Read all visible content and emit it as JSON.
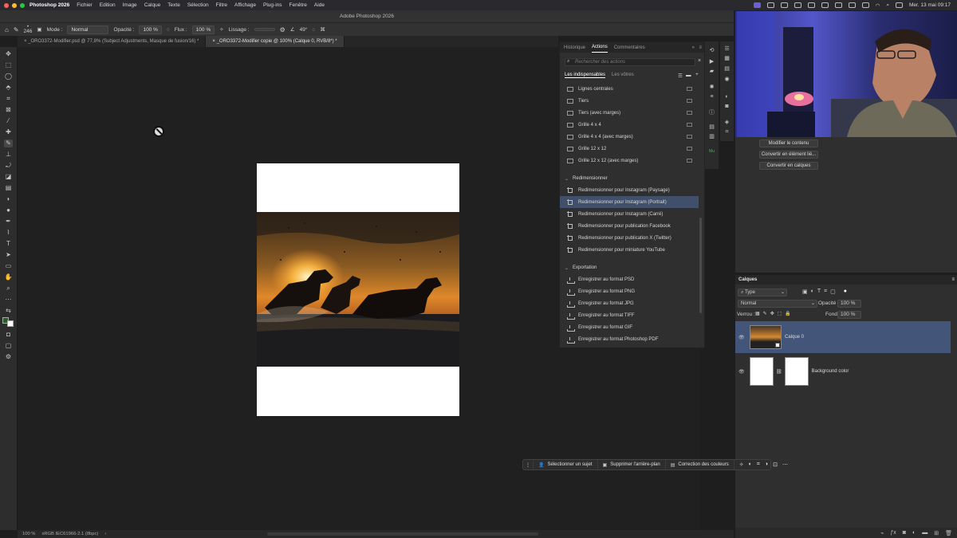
{
  "menubar": {
    "app_name": "Photoshop 2026",
    "items": [
      "Fichier",
      "Edition",
      "Image",
      "Calque",
      "Texte",
      "Sélection",
      "Filtre",
      "Affichage",
      "Plug-ins",
      "Fenêtre",
      "Aide"
    ],
    "datetime": "Mer. 13 mai 09:17"
  },
  "window_title": "Adobe Photoshop 2026",
  "options": {
    "brush_size": "246",
    "mode_label": "Mode :",
    "mode_value": "Normal",
    "opacity_label": "Opacité :",
    "opacity_value": "100 %",
    "flux_label": "Flux :",
    "flux_value": "100 %",
    "lissage_label": "Lissage :",
    "angle_value": "49°"
  },
  "tabs": [
    {
      "label": "_ORO3372-Modifier.psd @ 77,8% (Subject Adjustments, Masque de fusion/16) *"
    },
    {
      "label": "_ORO3372-Modifier copie @ 100% (Calque 0, RVB/8*) *"
    }
  ],
  "actions_panel": {
    "tabs": [
      "Historique",
      "Actions",
      "Commentaires"
    ],
    "search_placeholder": "Rechercher des actions",
    "sets": [
      "Les indispensables",
      "Les vôtres"
    ],
    "grid_items": [
      "Lignes centrales",
      "Tiers",
      "Tiers (avec marges)",
      "Grille 4 x 4",
      "Grille 4 x 4 (avec marges)",
      "Grille 12 x 12",
      "Grille 12 x 12 (avec marges)"
    ],
    "group_resize": "Redimensionner",
    "resize_items": [
      "Redimensionner pour Instagram (Paysage)",
      "Redimensionner pour Instagram (Portrait)",
      "Redimensionner pour Instagram (Carré)",
      "Redimensionner pour publication Facebook",
      "Redimensionner pour publication X (Twitter)",
      "Redimensionner pour miniature YouTube"
    ],
    "group_export": "Exportation",
    "export_items": [
      "Enregistrer au format PSD",
      "Enregistrer au format PNG",
      "Enregistrer au format JPG",
      "Enregistrer au format TIFF",
      "Enregistrer au format GIF",
      "Enregistrer au format Photoshop PDF"
    ]
  },
  "properties": {
    "buttons": [
      "Modifier le contenu",
      "Convertir en élément lié...",
      "Convertir en calques"
    ]
  },
  "layers": {
    "title": "Calques",
    "filter": "Type",
    "blend": "Normal",
    "opacity_label": "Opacité :",
    "opacity_value": "100 %",
    "lock_label": "Verrou :",
    "fill_label": "Fond :",
    "fill_value": "100 %",
    "items": [
      {
        "name": "Calque 0"
      },
      {
        "name": "Background color"
      }
    ]
  },
  "contextbar": {
    "btn1": "Sélectionner un sujet",
    "btn2": "Supprimer l'arrière-plan",
    "btn3": "Correction des couleurs"
  },
  "status": {
    "zoom": "100 %",
    "profile": "sRGB IEC61966-2.1 (8bpc)"
  }
}
